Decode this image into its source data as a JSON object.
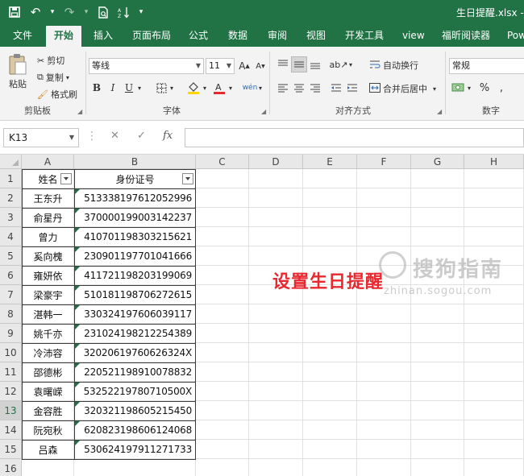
{
  "window": {
    "title": "生日提醒.xlsx - "
  },
  "ribbon_tabs": [
    "文件",
    "开始",
    "插入",
    "页面布局",
    "公式",
    "数据",
    "审阅",
    "视图",
    "开发工具",
    "view",
    "福昕阅读器",
    "Pow"
  ],
  "active_tab": "开始",
  "clipboard": {
    "paste": "粘贴",
    "cut": "剪切",
    "copy": "复制",
    "format_painter": "格式刷",
    "label": "剪贴板"
  },
  "font": {
    "name": "等线",
    "size": "11",
    "label": "字体",
    "bold": "B",
    "italic": "I",
    "underline": "U",
    "font_color": "#e8272e",
    "fill_color": "#ffd400"
  },
  "alignment": {
    "wrap_text": "自动换行",
    "merge_center": "合并后居中",
    "label": "对齐方式"
  },
  "number": {
    "format": "常规",
    "label": "数字",
    "percent": "%"
  },
  "formula_bar": {
    "name_box": "K13",
    "formula": ""
  },
  "columns": [
    "A",
    "B",
    "C",
    "D",
    "E",
    "F",
    "G",
    "H"
  ],
  "rows": [
    "1",
    "2",
    "3",
    "4",
    "5",
    "6",
    "7",
    "8",
    "9",
    "10",
    "11",
    "12",
    "13",
    "14",
    "15",
    "16"
  ],
  "selected_row": "13",
  "table": {
    "headers": [
      "姓名",
      "身份证号"
    ],
    "records": [
      [
        "王东升",
        "513338197612052996"
      ],
      [
        "俞星丹",
        "370000199003142237"
      ],
      [
        "曾力",
        "410701198303215621"
      ],
      [
        "奚向槐",
        "230901197701041666"
      ],
      [
        "雍妍依",
        "411721198203199069"
      ],
      [
        "梁豪宇",
        "510181198706272615"
      ],
      [
        "湛韩一",
        "330324197606039117"
      ],
      [
        "姚千亦",
        "231024198212254389"
      ],
      [
        "冷沛容",
        "32020619760626324X"
      ],
      [
        "邵德彬",
        "220521198910078832"
      ],
      [
        "袁曙嵘",
        "53252219780710500X"
      ],
      [
        "金容胜",
        "320321198605215450"
      ],
      [
        "阮宛秋",
        "620823198606124068"
      ],
      [
        "吕森",
        "530624197911271733"
      ]
    ]
  },
  "banner_text": "设置生日提醒",
  "watermark": {
    "cn": "搜狗指南",
    "en": "zhinan.sogou.com"
  },
  "accent_color": "#217346"
}
